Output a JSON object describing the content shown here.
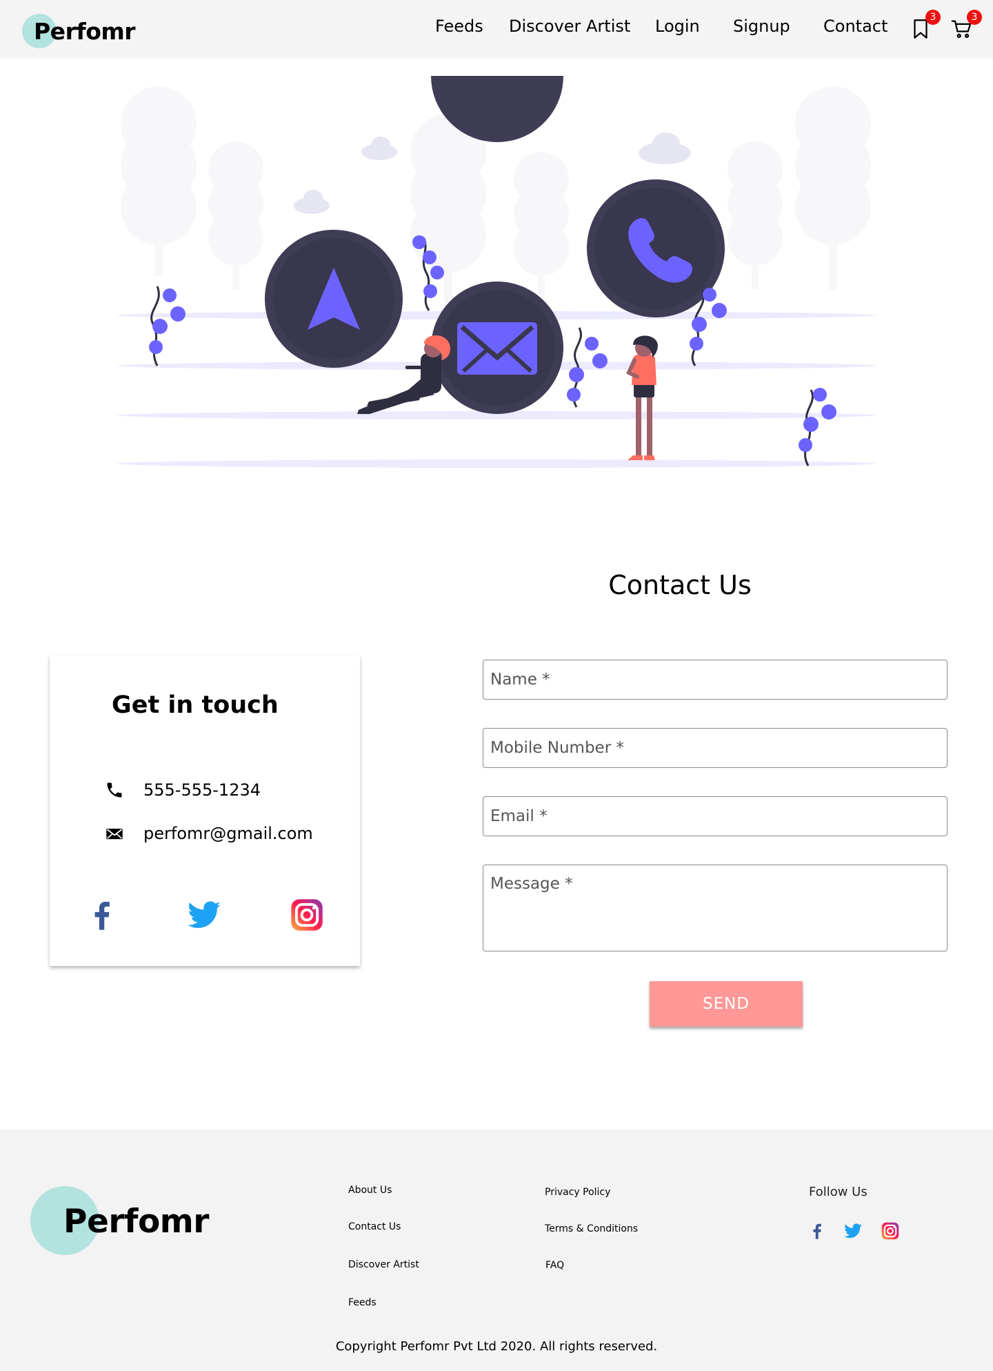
{
  "brand": {
    "name": "Perfomr",
    "accent": "#b3e3df"
  },
  "nav": {
    "links": [
      "Feeds",
      "Discover Artist",
      "Login",
      "Signup",
      "Contact"
    ],
    "bookmark_count": "3",
    "cart_count": "3",
    "icons": [
      "bookmark-icon",
      "cart-icon"
    ],
    "badge_color": "#ee1111"
  },
  "hero": {
    "illustration": "contact-illustration"
  },
  "contact": {
    "title": "Contact Us",
    "card": {
      "title": "Get in touch",
      "phone": "555-555-1234",
      "email": "perfomr@gmail.com",
      "social": [
        "facebook-icon",
        "twitter-icon",
        "instagram-icon"
      ]
    },
    "form": {
      "name_placeholder": "Name *",
      "mobile_placeholder": "Mobile Number *",
      "email_placeholder": "Email *",
      "message_placeholder": "Message *",
      "send_label": "SEND",
      "send_color": "#ff9896"
    }
  },
  "footer": {
    "brand": "Perfomr",
    "col1": [
      "About Us",
      "Contact Us",
      "Discover Artist",
      "Feeds"
    ],
    "col2": [
      "Privacy Policy",
      "Terms & Conditions",
      "FAQ"
    ],
    "follow_label": "Follow Us",
    "copyright": "Copyright Perfomr Pvt Ltd 2020. All rights reserved."
  }
}
